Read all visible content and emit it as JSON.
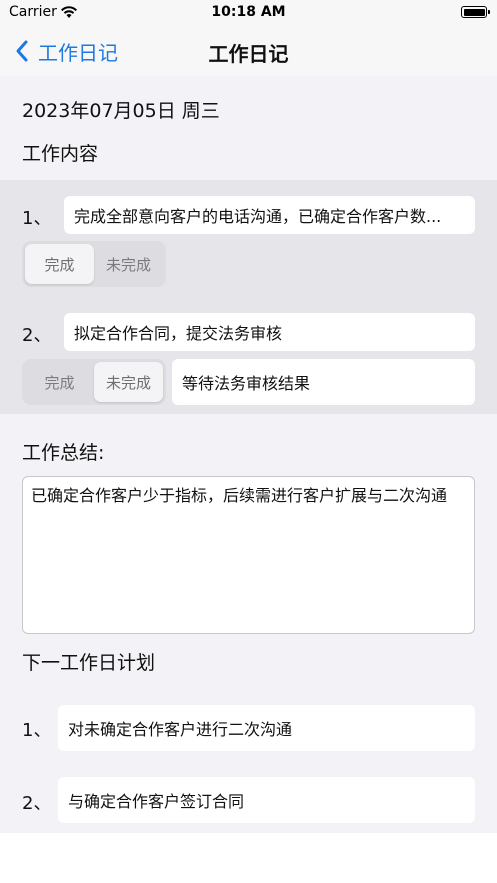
{
  "status_bar": {
    "carrier": "Carrier",
    "time": "10:18 AM"
  },
  "nav": {
    "back_label": "工作日记",
    "title": "工作日记"
  },
  "date": "2023年07月05日 周三",
  "work_content": {
    "title": "工作内容",
    "segment_labels": [
      "完成",
      "未完成"
    ],
    "items": [
      {
        "number": "1、",
        "text": "完成全部意向客户的电话沟通，已确定合作客户数...",
        "status": "完成",
        "remark": ""
      },
      {
        "number": "2、",
        "text": "拟定合作合同，提交法务审核",
        "status": "未完成",
        "remark": "等待法务审核结果"
      }
    ]
  },
  "summary": {
    "title": "工作总结:",
    "text": "已确定合作客户少于指标，后续需进行客户扩展与二次沟通"
  },
  "next_plan": {
    "title": "下一工作日计划",
    "items": [
      {
        "number": "1、",
        "text": "对未确定合作客户进行二次沟通"
      },
      {
        "number": "2、",
        "text": "与确定合作客户签订合同"
      }
    ]
  },
  "colors": {
    "accent": "#1f7ae0",
    "band": "#e5e5ea",
    "background": "#f2f2f7"
  }
}
